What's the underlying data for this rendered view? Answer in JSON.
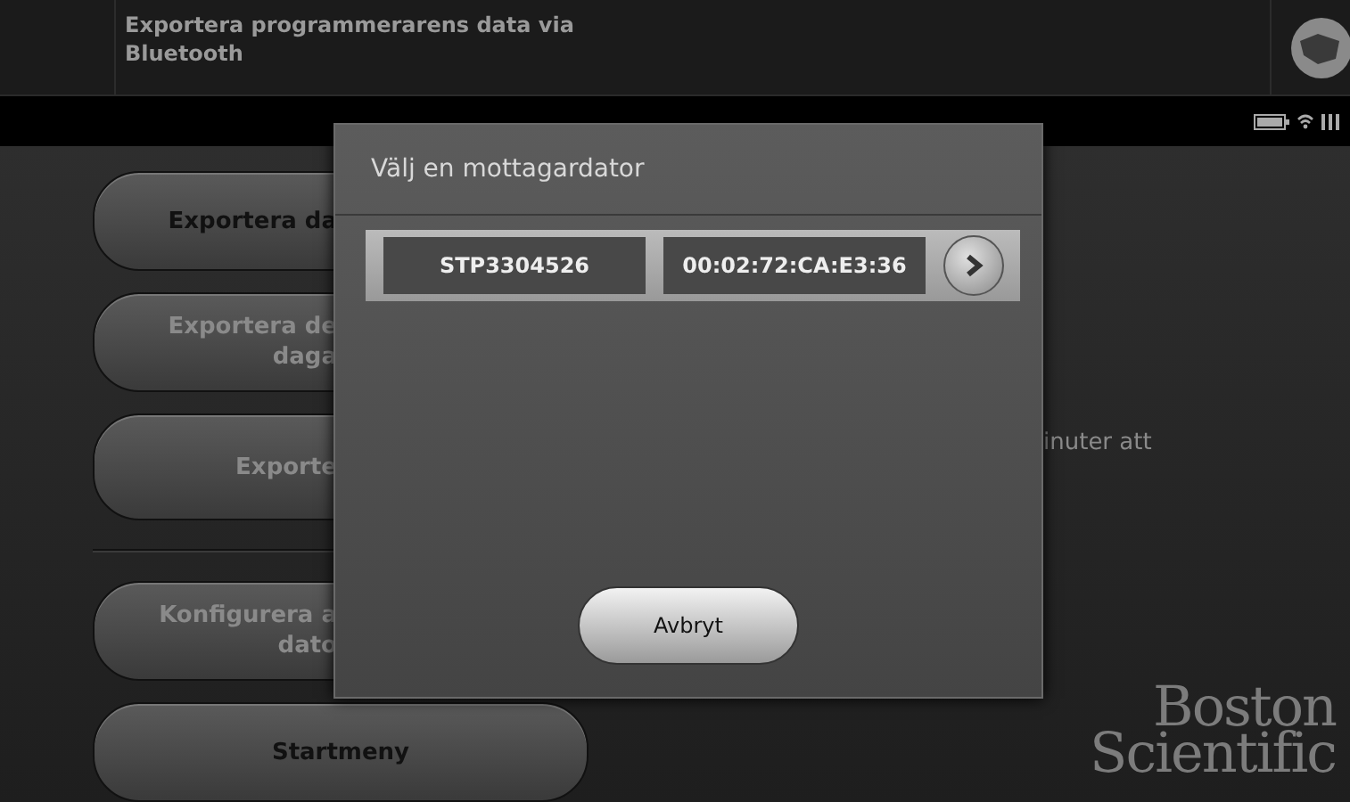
{
  "header": {
    "title": "Exportera programmerarens data via Bluetooth"
  },
  "menu_buttons": [
    {
      "lines": [
        "Exportera da"
      ],
      "disabled": false
    },
    {
      "lines": [
        "Exportera de",
        "daga"
      ],
      "disabled": true
    },
    {
      "lines": [
        "Exporte"
      ],
      "disabled": true
    },
    {
      "lines": [
        "Konfigurera a",
        "dato"
      ],
      "disabled": true
    }
  ],
  "home_button": {
    "label": "Startmeny"
  },
  "info_text": "inuter att",
  "logo": {
    "lines": [
      "Boston",
      "Scientific"
    ]
  },
  "dialog": {
    "title": "Välj en mottagardator",
    "devices": [
      {
        "name": "STP3304526",
        "address": "00:02:72:CA:E3:36"
      }
    ],
    "cancel": "Avbryt"
  }
}
